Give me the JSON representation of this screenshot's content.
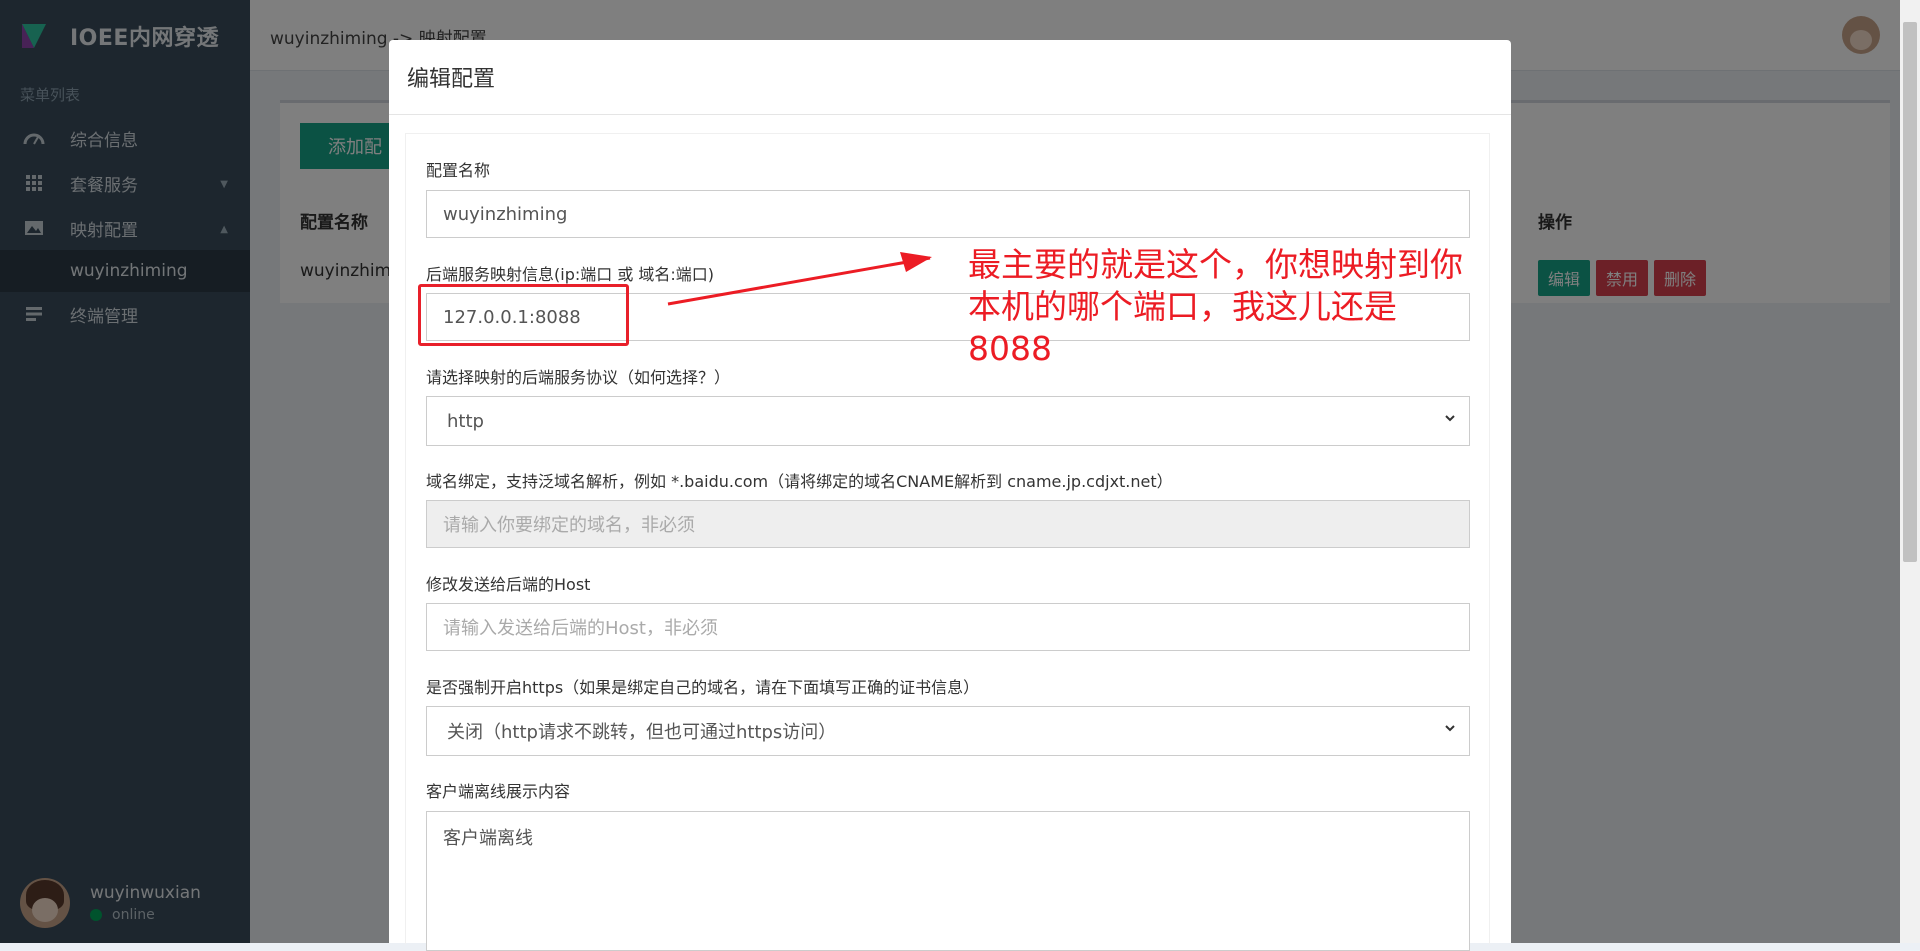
{
  "sidebar": {
    "brand": "IOEE内网穿透",
    "menu_header": "菜单列表",
    "items": [
      {
        "label": "综合信息",
        "icon": "dashboard-icon"
      },
      {
        "label": "套餐服务",
        "icon": "grid-icon"
      },
      {
        "label": "映射配置",
        "icon": "image-icon"
      },
      {
        "label": "终端管理",
        "icon": "list-icon"
      }
    ],
    "sub_item": "wuyinzhiming",
    "user": {
      "name": "wuyinwuxian",
      "status": "online"
    }
  },
  "topbar": {
    "breadcrumb": "wuyinzhiming -> 映射配置"
  },
  "background_page": {
    "add_button": "添加配",
    "col_name": "配置名称",
    "col_ops": "操作",
    "row_name": "wuyinzhimi",
    "ops": {
      "edit": "编辑",
      "disable": "禁用",
      "delete": "删除"
    }
  },
  "modal": {
    "title": "编辑配置",
    "name_label": "配置名称",
    "name_value": "wuyinzhiming",
    "backend_label": "后端服务映射信息(ip:端口 或 域名:端口)",
    "backend_value": "127.0.0.1:8088",
    "protocol_label": "请选择映射的后端服务协议（如何选择？）",
    "protocol_value": "http",
    "domain_label": "域名绑定，支持泛域名解析，例如 *.baidu.com（请将绑定的域名CNAME解析到 cname.jp.cdjxt.net）",
    "domain_placeholder": "请输入你要绑定的域名，非必须",
    "host_label": "修改发送给后端的Host",
    "host_placeholder": "请输入发送给后端的Host，非必须",
    "https_label": "是否强制开启https（如果是绑定自己的域名，请在下面填写正确的证书信息）",
    "https_value": "关闭（http请求不跳转，但也可通过https访问）",
    "offline_label": "客户端离线展示内容",
    "offline_value": "客户端离线"
  },
  "annotation": {
    "line1": "最主要的就是这个，你想映射到你",
    "line2": "本机的哪个端口，我这儿还是8088"
  },
  "colors": {
    "accent": "#17a589",
    "danger": "#d9414f",
    "annotation": "#ec1c24"
  }
}
